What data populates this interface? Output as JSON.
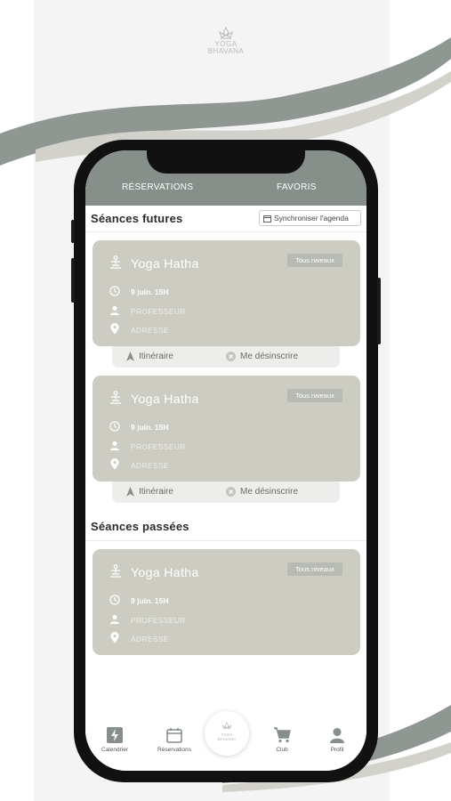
{
  "logo": {
    "line1": "YOGA",
    "line2": "BHAVANA"
  },
  "tabs": [
    {
      "label": "RÉSERVATIONS"
    },
    {
      "label": "FAVORIS"
    }
  ],
  "future": {
    "title": "Séances futures",
    "sync_label": "Synchroniser l'agenda",
    "sessions": [
      {
        "name": "Yoga Hatha",
        "level": "Tous niveaux",
        "date": "9 juin. 15H",
        "teacher": "PROFESSEUR",
        "address": "ADRESSE",
        "route_label": "Itinéraire",
        "unsubscribe_label": "Me désinscrire"
      },
      {
        "name": "Yoga Hatha",
        "level": "Tous niveaux",
        "date": "9 juin. 15H",
        "teacher": "PROFESSEUR",
        "address": "ADRESSE",
        "route_label": "Itinéraire",
        "unsubscribe_label": "Me désinscrire"
      }
    ]
  },
  "past": {
    "title": "Séances passées",
    "sessions": [
      {
        "name": "Yoga Hatha",
        "level": "Tous niveaux",
        "date": "9 juin. 15H",
        "teacher": "PROFESSEUR",
        "address": "ADRESSE"
      }
    ]
  },
  "nav": {
    "items": [
      {
        "label": "Calendrier",
        "icon": "bolt-icon"
      },
      {
        "label": "Réservations",
        "icon": "calendar-icon"
      },
      {
        "label": "Club",
        "icon": "cart-icon"
      },
      {
        "label": "Profil",
        "icon": "user-icon"
      }
    ],
    "center": {
      "line1": "YOGA",
      "line2": "BHAVANA"
    }
  },
  "colors": {
    "header": "#868f89",
    "card": "#cdccc2",
    "actions": "#ededeb",
    "swoosh": "#8e9791"
  }
}
